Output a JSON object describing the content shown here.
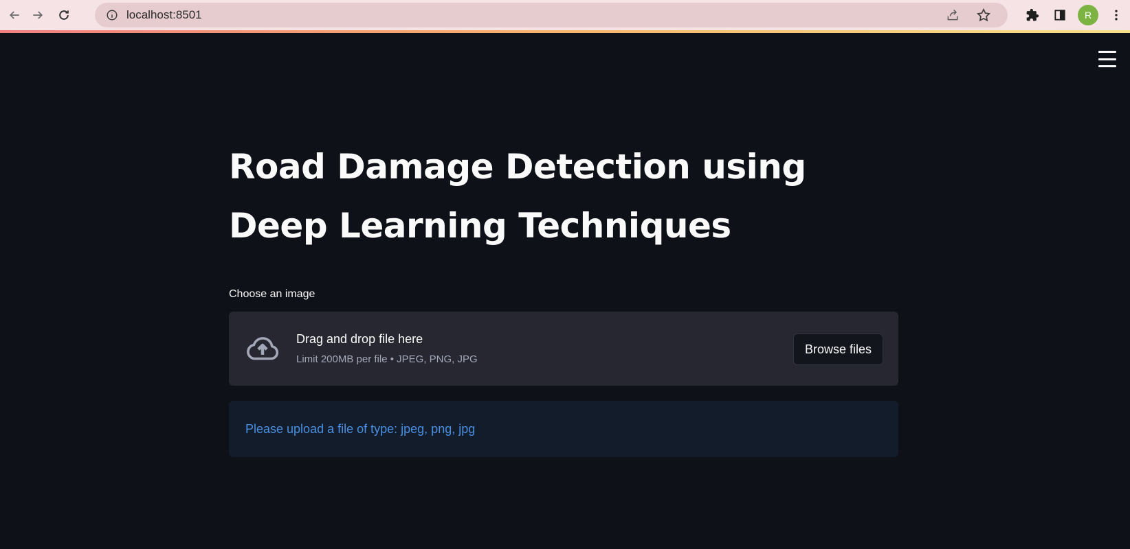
{
  "browser": {
    "url": "localhost:8501",
    "avatar_letter": "R",
    "icons": [
      "back-icon",
      "forward-icon",
      "reload-icon",
      "info-icon",
      "share-icon",
      "star-icon",
      "extensions-icon",
      "side-panel-icon",
      "more-vert-icon"
    ]
  },
  "app": {
    "title": "Road Damage Detection using Deep Learning Techniques",
    "uploader": {
      "label": "Choose an image",
      "drop_text": "Drag and drop file here",
      "limit_text": "Limit 200MB per file • JPEG, PNG, JPG",
      "browse_label": "Browse files"
    },
    "info_message": "Please upload a file of type: jpeg, png, jpg"
  },
  "colors": {
    "background": "#0e1117",
    "dropzone": "#262730",
    "info_bg": "#131c2b",
    "info_text": "#4a90e2",
    "avatar": "#7cb342"
  }
}
